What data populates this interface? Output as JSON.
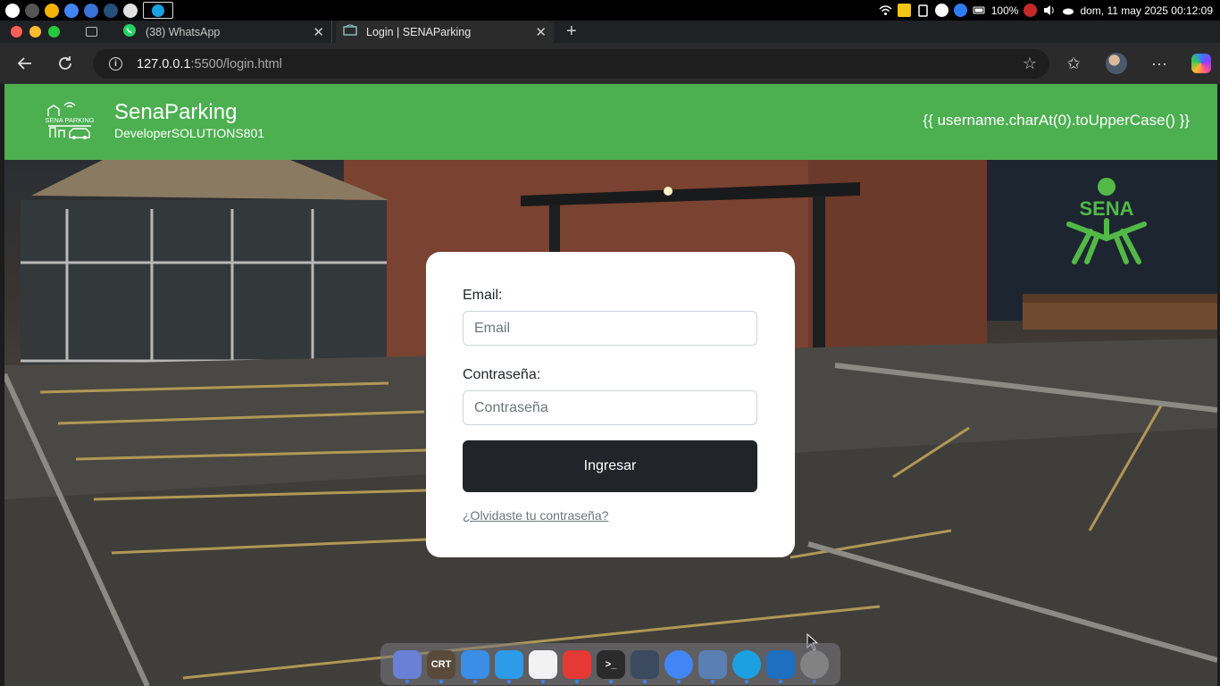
{
  "os_bar": {
    "battery": "100%",
    "datetime": "dom, 11 may 2025 00:12:09",
    "apps": [
      {
        "icon": "apple-icon",
        "color": "#ffffff"
      },
      {
        "icon": "clock-app-icon",
        "color": "#555555"
      },
      {
        "icon": "chrome-canary-icon",
        "color": "#f4b400"
      },
      {
        "icon": "chrome-icon",
        "color": "#4285f4"
      },
      {
        "icon": "firefox-icon",
        "color": "#3a73d9"
      },
      {
        "icon": "bird-app-icon",
        "color": "#24507a"
      },
      {
        "icon": "camera-app-icon",
        "color": "#e0e0e0"
      },
      {
        "icon": "edge-icon",
        "color": "#1ba1e2"
      }
    ]
  },
  "browser": {
    "tabs": [
      {
        "title": "(38) WhatsApp",
        "icon": "whatsapp-icon",
        "active": false
      },
      {
        "title": "Login | SENAParking",
        "icon": "sena-favicon-icon",
        "active": true
      }
    ],
    "url_host": "127.0.0.1",
    "url_path": ":5500/login.html"
  },
  "header": {
    "logo_label": "SENA PARKING",
    "title": "SenaParking",
    "subtitle": "DeveloperSOLUTIONS801",
    "user_template": "{{ username.charAt(0).toUpperCase() }}"
  },
  "hero": {
    "logo_text": "SENA"
  },
  "login": {
    "email_label": "Email:",
    "email_placeholder": "Email",
    "password_label": "Contraseña:",
    "password_placeholder": "Contraseña",
    "submit_label": "Ingresar",
    "forgot_label": "¿Olvidaste tu contraseña?"
  },
  "dock": {
    "apps": [
      {
        "icon": "launchpad-icon",
        "color": "#6a7fd6",
        "text": ""
      },
      {
        "icon": "crt-terminal-icon",
        "color": "#5a4a3a",
        "text": "CRT"
      },
      {
        "icon": "finder-icon",
        "color": "#3a8ee6",
        "text": ""
      },
      {
        "icon": "safari-icon",
        "color": "#2d9be8",
        "text": ""
      },
      {
        "icon": "photos-icon",
        "color": "#f2f2f2",
        "text": ""
      },
      {
        "icon": "screen-recorder-icon",
        "color": "#e53935",
        "text": ""
      },
      {
        "icon": "terminal-icon",
        "color": "#2b2b2b",
        "text": ">_"
      },
      {
        "icon": "files-icon",
        "color": "#3b4a5e",
        "text": ""
      },
      {
        "icon": "chrome-icon",
        "color": "#4285f4",
        "text": ""
      },
      {
        "icon": "docker-icon",
        "color": "#5b7fb3",
        "text": ""
      },
      {
        "icon": "edge-icon",
        "color": "#1ba1e2",
        "text": ""
      },
      {
        "icon": "vscode-icon",
        "color": "#1e6fbf",
        "text": ""
      },
      {
        "icon": "trash-icon",
        "color": "#9a9a9a",
        "text": ""
      }
    ]
  }
}
